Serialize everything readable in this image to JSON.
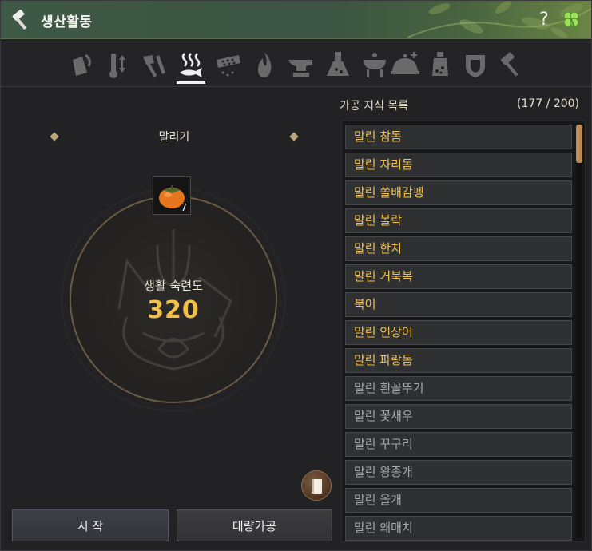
{
  "window": {
    "title": "생산활동",
    "help_label": "?",
    "title_icon": "hammer-icon",
    "clover_icon": "clover-icon"
  },
  "tabs": [
    {
      "icon": "gathering-icon",
      "active": false
    },
    {
      "icon": "taming-icon",
      "active": false
    },
    {
      "icon": "chopping-icon",
      "active": false
    },
    {
      "icon": "drying-icon",
      "active": true
    },
    {
      "icon": "filtering-icon",
      "active": false
    },
    {
      "icon": "heating-icon",
      "active": false
    },
    {
      "icon": "anvil-icon",
      "active": false
    },
    {
      "icon": "alchemy-flask-icon",
      "active": false
    },
    {
      "icon": "grill-icon",
      "active": false
    },
    {
      "icon": "serving-dish-icon",
      "active": false
    },
    {
      "icon": "shaking-icon",
      "active": false
    },
    {
      "icon": "guild-shield-icon",
      "active": false
    },
    {
      "icon": "craft-hammer-icon",
      "active": false
    }
  ],
  "left": {
    "subcategory": "말리기",
    "mastery_label": "생활 숙련도",
    "mastery_value": "320",
    "item_slot": {
      "icon": "persimmon-icon",
      "count": "7"
    },
    "book_icon": "book-icon",
    "start_button": "시 작",
    "bulk_button": "대량가공"
  },
  "right": {
    "title": "가공 지식 목록",
    "count": "(177 / 200)",
    "items": [
      {
        "label": "말린 참돔",
        "known": true
      },
      {
        "label": "말린 자리돔",
        "known": true
      },
      {
        "label": "말린 쏠배감펭",
        "known": true
      },
      {
        "label": "말린 볼락",
        "known": true
      },
      {
        "label": "말린 한치",
        "known": true
      },
      {
        "label": "말린 거북복",
        "known": true
      },
      {
        "label": "북어",
        "known": true
      },
      {
        "label": "말린 인상어",
        "known": true
      },
      {
        "label": "말린 파랑돔",
        "known": true
      },
      {
        "label": "말린 흰꼴뚜기",
        "known": false
      },
      {
        "label": "말린 꽃새우",
        "known": false
      },
      {
        "label": "말린 꾸구리",
        "known": false
      },
      {
        "label": "말린 왕종개",
        "known": false
      },
      {
        "label": "말린 올개",
        "known": false
      },
      {
        "label": "말린 왜매치",
        "known": false
      }
    ]
  },
  "colors": {
    "known_item": "#f2c24d",
    "unknown_item": "#a8a8a8",
    "mastery_value": "#f0c04a",
    "titlebar": "#3f5946",
    "scroll_thumb": "#b98d5a"
  }
}
